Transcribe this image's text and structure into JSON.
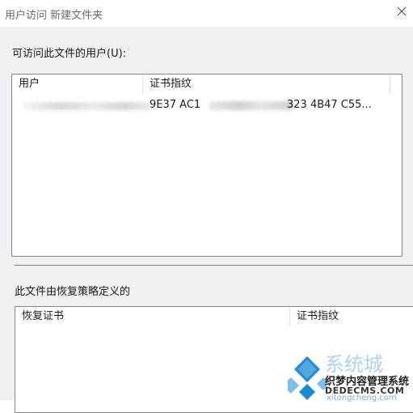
{
  "window": {
    "title": "用户访问 新建文件夹",
    "close_icon": "close-icon"
  },
  "users_section": {
    "label": "可访问此文件的用户(U):",
    "columns": [
      "用户",
      "证书指纹"
    ],
    "rows": [
      {
        "user": "",
        "thumbprint_start": "9E37 AC1",
        "thumbprint_end": "323 4B47 C55..."
      }
    ]
  },
  "recovery_section": {
    "label": "此文件由恢复策略定义的",
    "columns": [
      "恢复证书",
      "证书指纹"
    ]
  },
  "watermark": {
    "brand_cn": "系统城",
    "dede_cn": "织梦内容管理系统",
    "dede_en": "DEDECMS.COM",
    "site": "xitongcheng.com",
    "colors": {
      "logo_blue": "#1a8ad4",
      "logo_light": "#7cc0ea"
    }
  }
}
